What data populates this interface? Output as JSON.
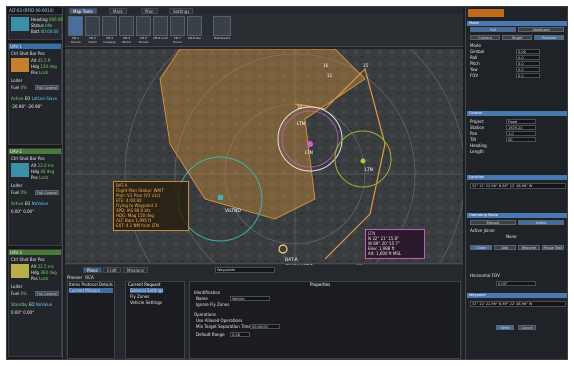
{
  "left": {
    "top_label": "ALT-03 (RFID 00-0014)",
    "rows": [
      [
        "Heading",
        "000.00",
        "NE"
      ],
      [
        "Status",
        "Idle",
        ""
      ],
      [
        "Batt",
        "00:00:00",
        ""
      ]
    ],
    "vehicles": [
      {
        "name": "UAV-1",
        "tags": [
          "Ctrl",
          "Shot",
          "Bar",
          "Pos"
        ],
        "vals": [
          [
            "Alt",
            "45.5 ft",
            "Spd",
            "40 kts"
          ],
          [
            "Hdg",
            "120 deg",
            "Tgt",
            "42.0 ft"
          ],
          [
            "Pos",
            "Lock",
            "Err",
            "3.0 ft"
          ]
        ],
        "mode": "Loiter",
        "stats": [
          [
            "Fuel",
            "0%",
            "Full Control"
          ]
        ],
        "engine": [
          "Active",
          "EO",
          "LatLon Slave"
        ],
        "coords": [
          "-26.98°",
          "-26.98°",
          "50.98°"
        ]
      },
      {
        "name": "UAV-2",
        "tags": [
          "Ctrl",
          "Shot",
          "Bar",
          "Pos"
        ],
        "vals": [
          [
            "Alt",
            "22.0 ms",
            "Spd",
            "22.0 ms"
          ],
          [
            "Hdg",
            "40 deg",
            "Tgt",
            "95 deg"
          ],
          [
            "Pos",
            "Lock",
            "Err",
            "0.0 ft"
          ]
        ],
        "mode": "Loiter",
        "stats": [
          [
            "Fuel",
            "0%",
            "Full Control"
          ]
        ],
        "engine": [
          "Active",
          "EO",
          "NoValue"
        ],
        "coords": [
          "0.00°",
          "0.00°",
          "0.00°"
        ]
      },
      {
        "name": "UAV-3",
        "tags": [
          "Ctrl",
          "Shot",
          "Bar",
          "Pos"
        ],
        "vals": [
          [
            "Alt",
            "22.5 ms",
            "Spd",
            "22.5 ms"
          ],
          [
            "Hdg",
            "360 deg",
            "Tgt",
            "360 deg"
          ],
          [
            "Pos",
            "Lock",
            "Err",
            "270 ft"
          ]
        ],
        "mode": "Loiter",
        "stats": [
          [
            "Fuel",
            "0%",
            "Full Control"
          ]
        ],
        "engine": [
          "Standby",
          "EO",
          "NoValue"
        ],
        "coords": [
          "0.00°",
          "0.00°",
          "0.00°"
        ]
      }
    ]
  },
  "menu": [
    "Map Tools",
    "Mark",
    "Plan",
    "Settings"
  ],
  "ribbon": [
    "CB-1 Theme",
    "CB-2 Chart",
    "CB-3 Imagery",
    "CB-4 Vector",
    "CB-5 Terrain",
    "CB-6 Grid",
    "CB-7 Zoom",
    "CB-8 Rec",
    "Dashboard"
  ],
  "map": {
    "labels": [
      "LTN",
      "VILTND",
      "LTN",
      "LTN",
      "BAT-A",
      "16",
      "15",
      "12",
      "10"
    ],
    "box1": [
      "BAT-A",
      "Flight Plan Status: WAIT",
      "Plan: V1 Plan (V1 v1c)",
      "ETE: 4:00:00",
      "Flying to Waypoint 3",
      "SPD: IAS 69.0 kts",
      "HDG: Mag 150 deg",
      "ALT: Baro 1,995 ft",
      "EXT: 4.1 NM from LTN"
    ],
    "box2": [
      "LTN",
      "N 32° 21' 15.8\"",
      "W 89° 20' 55.7\"",
      "Elev: 1,988 ft",
      "Alt: 1,600 ft MSL"
    ],
    "scale": "Elevation:1,988 ft",
    "zoom": "4 mi"
  },
  "bottom": {
    "tabs": [
      "Plans",
      "Craft",
      "Missions"
    ],
    "search": "Waypoints",
    "sub": [
      "Planner",
      "OCA"
    ],
    "tree_tabs": [
      "Items",
      "Protocol",
      "Details"
    ],
    "tree": [
      "Current Request",
      "General Settings",
      "Fly Zones",
      "Vehicle Settings"
    ],
    "left_item": "Current Mission",
    "props": "Properties",
    "prop_rows": [
      [
        "Identification",
        ""
      ],
      [
        "Name",
        "Vehicle"
      ],
      [
        "Ignore Fly Zones",
        ""
      ],
      [
        "Operations",
        ""
      ],
      [
        "Use Aliased Operations",
        ""
      ],
      [
        "Min Target Separation Time",
        "00:00:00"
      ],
      [
        "Default Range",
        "0.28"
      ]
    ]
  },
  "right": {
    "sec1": "Mode",
    "mode_btns": [
      "Full",
      "Stabilized"
    ],
    "sub": [
      "Camera",
      "Target",
      "Payload"
    ],
    "rows": [
      [
        "Mode",
        ""
      ],
      [
        "Gimbal",
        "0.00"
      ],
      [
        "Roll",
        "0.0"
      ],
      [
        "Pitch",
        "0.0"
      ],
      [
        "Yaw",
        "0.0"
      ],
      [
        "FOV",
        "0.0"
      ]
    ],
    "sec2": "Control",
    "ctl": [
      [
        "Project",
        "Fixed"
      ],
      [
        "Station",
        "1929.22"
      ],
      [
        "Pan",
        "1.0"
      ],
      [
        "Tilt",
        "00"
      ],
      [
        "Heading",
        ""
      ],
      [
        "Length",
        ""
      ]
    ],
    "sec3": "Location",
    "loc": [
      "32° 22' 22.96\" N",
      "89° 22' 48.96\" W"
    ],
    "sec4": "Operating Mode",
    "op": [
      "Manual",
      "Active"
    ],
    "sec5": "Active Joiner",
    "joiner": "None",
    "btns": [
      "Close",
      "Add",
      "Resume",
      "Pause Task"
    ],
    "sec6": "Waypoint",
    "wp": [
      "32° 22' 22.96\" N",
      "89° 22' 48.96\" W"
    ],
    "ok": [
      "Send",
      "Cancel"
    ],
    "fov": "Horizontal FOV",
    "fov_val": "0.00°"
  }
}
